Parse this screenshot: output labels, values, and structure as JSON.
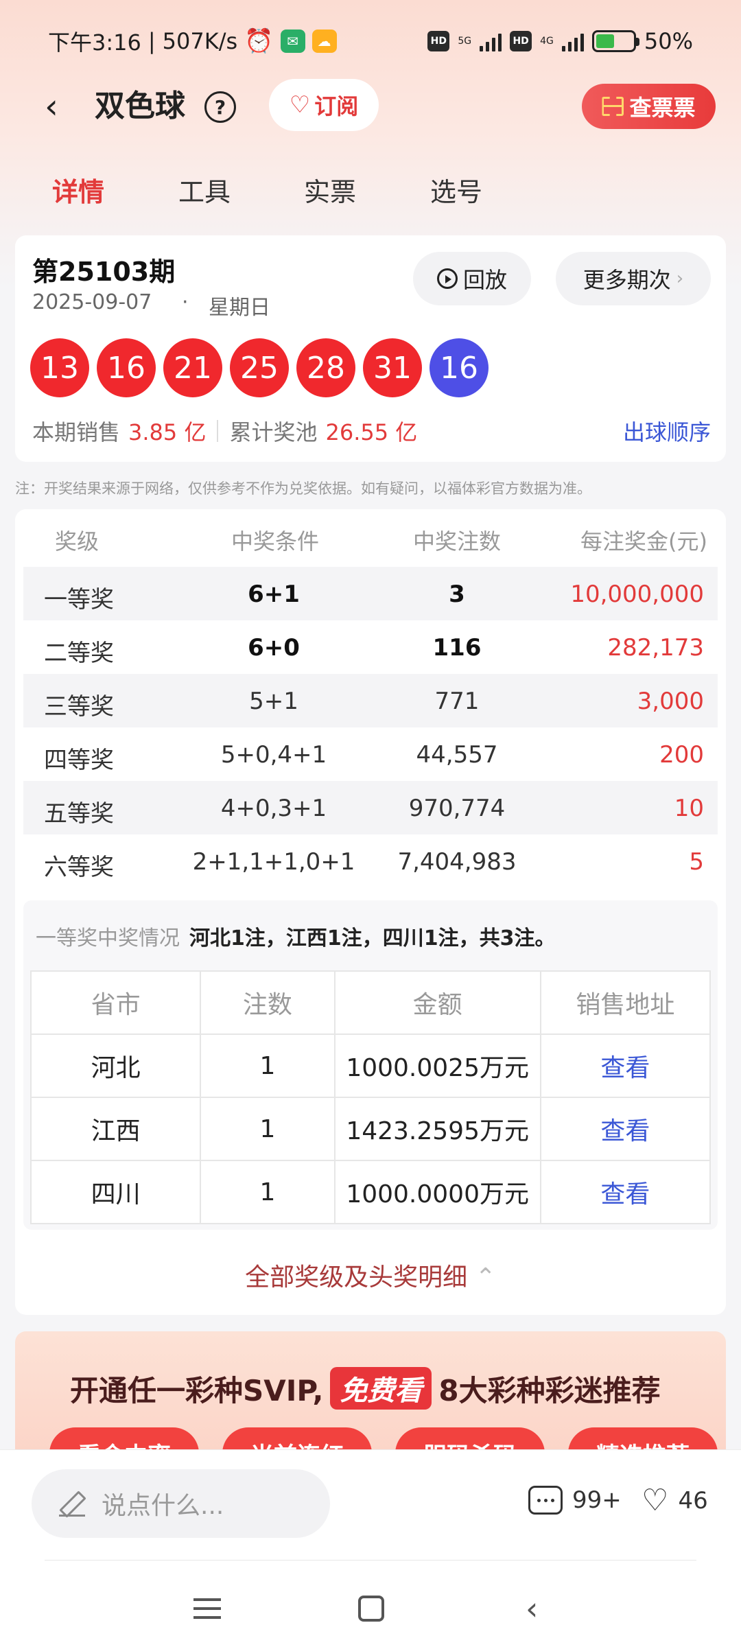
{
  "status_bar": {
    "time": "下午3:16",
    "net_speed": "507K/s",
    "hd1": "HD",
    "net1": "5G",
    "hd2": "HD",
    "net2": "4G",
    "battery": "50%"
  },
  "header": {
    "title": "双色球",
    "help_glyph": "?",
    "subscribe_label": "订阅",
    "check_ticket_label": "查票票"
  },
  "tabs": [
    {
      "label": "详情",
      "active": true
    },
    {
      "label": "工具",
      "active": false
    },
    {
      "label": "实票",
      "active": false
    },
    {
      "label": "选号",
      "active": false
    }
  ],
  "result": {
    "issue": "第25103期",
    "date": "2025-09-07",
    "dot": "·",
    "weekday": "星期日",
    "replay_label": "回放",
    "more_issues_label": "更多期次",
    "red_balls": [
      "13",
      "16",
      "21",
      "25",
      "28",
      "31"
    ],
    "blue_ball": "16",
    "sales_label": "本期销售",
    "sales_value": "3.85 亿",
    "pool_label": "累计奖池",
    "pool_value": "26.55 亿",
    "order_link": "出球顺序"
  },
  "note": "注：开奖结果来源于网络，仅供参考不作为兑奖依据。如有疑问，以福体彩官方数据为准。",
  "prize_table": {
    "headers": [
      "奖级",
      "中奖条件",
      "中奖注数",
      "每注奖金(元)"
    ],
    "rows": [
      {
        "level": "一等奖",
        "condition": "6+1",
        "count": "3",
        "prize": "10,000,000"
      },
      {
        "level": "二等奖",
        "condition": "6+0",
        "count": "116",
        "prize": "282,173"
      },
      {
        "level": "三等奖",
        "condition": "5+1",
        "count": "771",
        "prize": "3,000"
      },
      {
        "level": "四等奖",
        "condition": "5+0,4+1",
        "count": "44,557",
        "prize": "200"
      },
      {
        "level": "五等奖",
        "condition": "4+0,3+1",
        "count": "970,774",
        "prize": "10"
      },
      {
        "level": "六等奖",
        "condition": "2+1,1+1,0+1",
        "count": "7,404,983",
        "prize": "5"
      }
    ]
  },
  "winners": {
    "label": "一等奖中奖情况",
    "summary": "河北1注，江西1注，四川1注，共3注。",
    "headers": [
      "省市",
      "注数",
      "金额",
      "销售地址"
    ],
    "rows": [
      {
        "province": "河北",
        "count": "1",
        "amount": "1000.0025万元",
        "link": "查看"
      },
      {
        "province": "江西",
        "count": "1",
        "amount": "1423.2595万元",
        "link": "查看"
      },
      {
        "province": "四川",
        "count": "1",
        "amount": "1000.0000万元",
        "link": "查看"
      }
    ]
  },
  "all_prizes_link": "全部奖级及头奖明细",
  "banner": {
    "title_pre": "开通任一彩种SVIP,",
    "badge": "免费看",
    "title_post": "8大彩种彩迷推荐",
    "pills": [
      "看命中率",
      "当前连红",
      "胆码杀码",
      "精选推荐"
    ]
  },
  "bottom": {
    "comment_placeholder": "说点什么...",
    "comment_count": "99+",
    "like_count": "46"
  },
  "colors": {
    "red_ball": "#f0282d",
    "blue_ball": "#4e4fe6",
    "accent_red": "#e23a3a",
    "link_blue": "#3b57d6"
  }
}
